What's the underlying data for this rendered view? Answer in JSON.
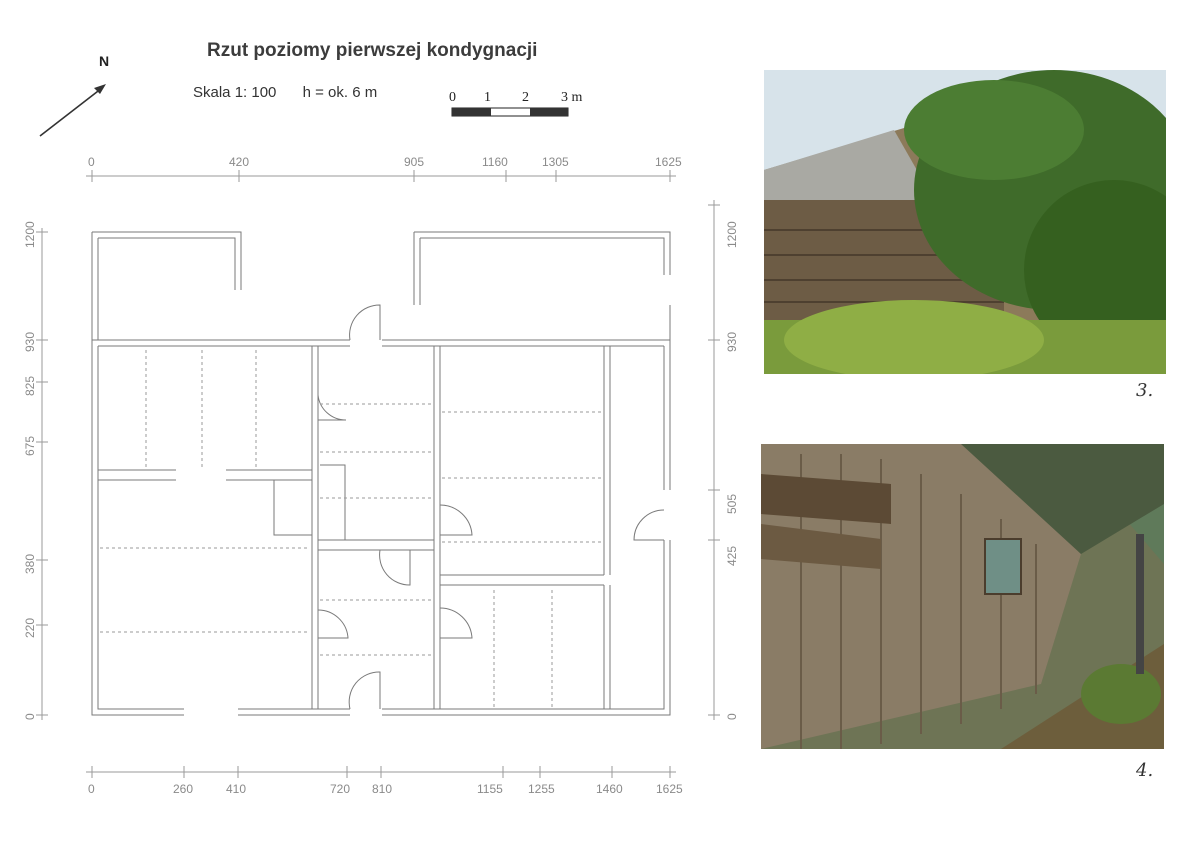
{
  "drawing": {
    "title": "Rzut poziomy pierwszej kondygnacji",
    "scale_label": "Skala 1: 100",
    "height_label": "h = ok. 6 m",
    "north_label": "N",
    "scale_bar_labels": [
      "0",
      "1",
      "2",
      "3 m"
    ]
  },
  "dimensions": {
    "top": [
      "0",
      "420",
      "905",
      "1160",
      "1305",
      "1625"
    ],
    "bottom": [
      "0",
      "260",
      "410",
      "720",
      "810",
      "1155",
      "1255",
      "1460",
      "1625"
    ],
    "left": [
      "1200",
      "930",
      "825",
      "675",
      "380",
      "220",
      "0"
    ],
    "right": [
      "1200",
      "930",
      "505",
      "425",
      "0"
    ]
  },
  "photos": [
    {
      "label": "3."
    },
    {
      "label": "4."
    }
  ],
  "colors": {
    "wall_line": "#7a7a7a",
    "dim_text": "#8a8a8a",
    "sky": "#cfe0ee",
    "foliage": "#3f6b2a",
    "wood": "#7a6a55"
  }
}
